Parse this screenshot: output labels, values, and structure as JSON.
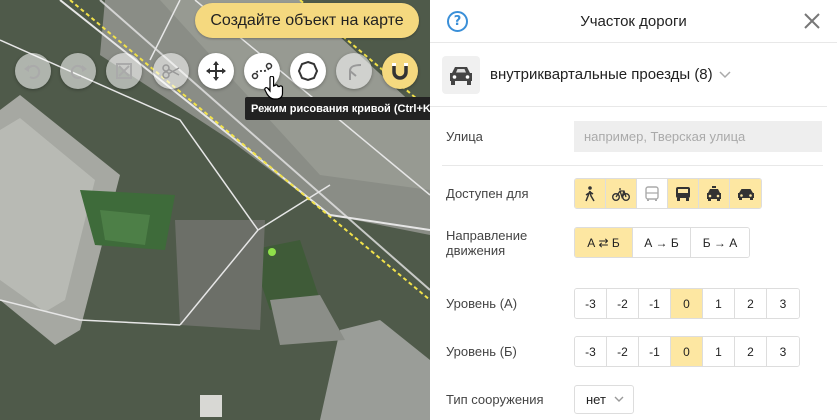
{
  "map": {
    "create_button": "Создайте объект на карте",
    "tooltip": "Режим рисования кривой (Ctrl+K)",
    "tools": [
      {
        "icon": "undo-icon",
        "enabled": false
      },
      {
        "icon": "redo-icon",
        "enabled": false
      },
      {
        "icon": "delete-vertex-icon",
        "enabled": false
      },
      {
        "icon": "scissors-icon",
        "enabled": false
      },
      {
        "icon": "move-icon",
        "enabled": true
      },
      {
        "icon": "curve-draw-icon",
        "enabled": true
      },
      {
        "icon": "circle-icon",
        "enabled": true
      },
      {
        "icon": "branch-icon",
        "enabled": false
      },
      {
        "icon": "magnet-icon",
        "enabled": true,
        "active": true
      }
    ]
  },
  "panel": {
    "title": "Участок дороги",
    "type_label": "внутриквартальные проезды (8)",
    "street": {
      "label": "Улица",
      "placeholder": "например, Тверская улица"
    },
    "access": {
      "label": "Доступен для",
      "options": [
        {
          "icon": "pedestrian-icon",
          "on": true
        },
        {
          "icon": "bicycle-icon",
          "on": true
        },
        {
          "icon": "bus-icon",
          "on": false
        },
        {
          "icon": "truck-icon",
          "on": true
        },
        {
          "icon": "taxi-icon",
          "on": true
        },
        {
          "icon": "car-icon",
          "on": true
        }
      ]
    },
    "direction": {
      "label": "Направление движения",
      "options": [
        "А ⇄ Б",
        "А → Б",
        "Б → А"
      ],
      "selected": 0
    },
    "level_a": {
      "label": "Уровень (А)",
      "options": [
        "-3",
        "-2",
        "-1",
        "0",
        "1",
        "2",
        "3"
      ],
      "selected": 3
    },
    "level_b": {
      "label": "Уровень (Б)",
      "options": [
        "-3",
        "-2",
        "-1",
        "0",
        "1",
        "2",
        "3"
      ],
      "selected": 3
    },
    "structure": {
      "label": "Тип сооружения",
      "value": "нет"
    }
  }
}
